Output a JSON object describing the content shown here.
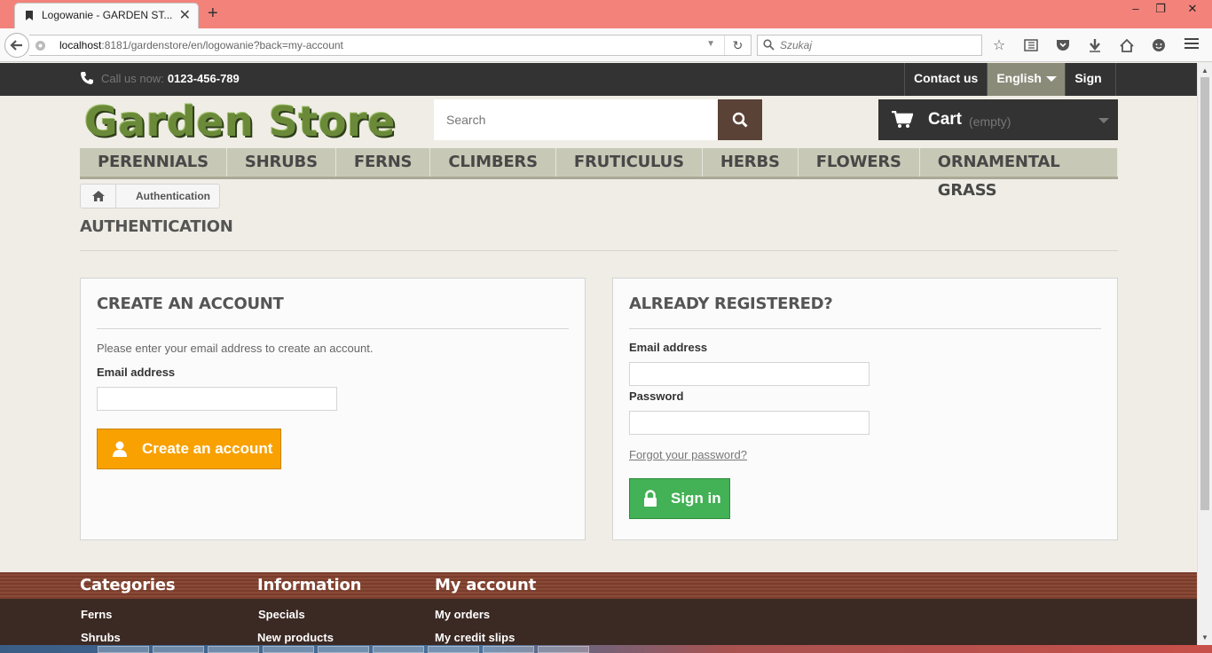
{
  "browser": {
    "tab_title": "Logowanie - GARDEN ST...",
    "url_host": "localhost",
    "url_rest": ":8181/gardenstore/en/logowanie?back=my-account",
    "search_placeholder": "Szukaj"
  },
  "header": {
    "call_label": "Call us now:",
    "phone": "0123-456-789",
    "contact": "Contact us",
    "language": "English",
    "sign_in": "Sign in",
    "logo": "Garden Store",
    "search_placeholder": "Search",
    "cart_label": "Cart",
    "cart_status": "(empty)"
  },
  "menu": [
    "PERENNIALS",
    "SHRUBS",
    "FERNS",
    "CLIMBERS",
    "FRUTICULUS",
    "HERBS",
    "FLOWERS",
    "ORNAMENTAL GRASS"
  ],
  "breadcrumb": {
    "current": "Authentication"
  },
  "page": {
    "heading": "AUTHENTICATION"
  },
  "create_account": {
    "title": "CREATE AN ACCOUNT",
    "intro": "Please enter your email address to create an account.",
    "email_label": "Email address",
    "email_value": "",
    "button": "Create an account"
  },
  "login": {
    "title": "ALREADY REGISTERED?",
    "email_label": "Email address",
    "email_value": "",
    "password_label": "Password",
    "password_value": "",
    "forgot": "Forgot your password?",
    "button": "Sign in"
  },
  "footer": {
    "categories": {
      "title": "Categories",
      "links": [
        "Ferns",
        "Shrubs"
      ]
    },
    "information": {
      "title": "Information",
      "links": [
        "Specials",
        "New products"
      ]
    },
    "my_account": {
      "title": "My account",
      "links": [
        "My orders",
        "My credit slips"
      ]
    }
  },
  "colors": {
    "browser_titlebar": "#f3827a",
    "topbar": "#333333",
    "menu_bg": "#c8c8b6",
    "create_button": "#f8a100",
    "signin_button": "#43b155",
    "search_button": "#5b4236",
    "footer": "#3b2923"
  }
}
